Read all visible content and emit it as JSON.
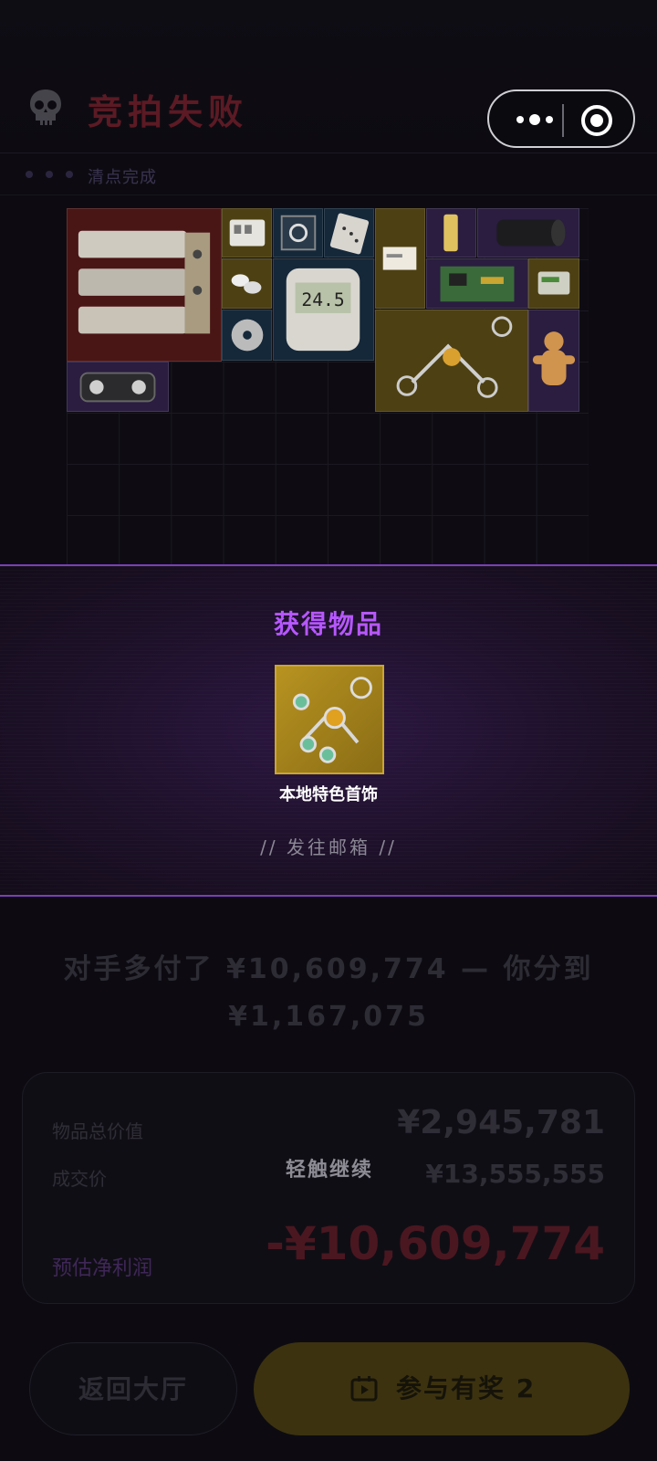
{
  "header": {
    "title": "竞拍失败",
    "subtitle": "清点完成",
    "skull_icon": "skull-icon",
    "more_icon": "more-dots-icon",
    "close_icon": "target-close-icon"
  },
  "inventory": {
    "items": [
      {
        "icon": "server-rack-icon",
        "rarity": "red"
      },
      {
        "icon": "switch-panel-icon",
        "rarity": "gold"
      },
      {
        "icon": "boxed-coil-icon",
        "rarity": "blue"
      },
      {
        "icon": "card-icon",
        "rarity": "blue"
      },
      {
        "icon": "small-card-icon",
        "rarity": "gold"
      },
      {
        "icon": "tube-icon",
        "rarity": "purple"
      },
      {
        "icon": "camera-lens-icon",
        "rarity": "purple"
      },
      {
        "icon": "capsules-icon",
        "rarity": "gold"
      },
      {
        "icon": "digital-scale-icon",
        "rarity": "blue",
        "label": "24.5"
      },
      {
        "icon": "circuit-board-icon",
        "rarity": "purple"
      },
      {
        "icon": "cartridge-icon",
        "rarity": "gold"
      },
      {
        "icon": "disc-icon",
        "rarity": "blue"
      },
      {
        "icon": "jewelry-icon",
        "rarity": "gold"
      },
      {
        "icon": "gingerbread-icon",
        "rarity": "purple"
      },
      {
        "icon": "radio-icon",
        "rarity": "purple"
      }
    ]
  },
  "acquired": {
    "title": "获得物品",
    "item_name": "本地特色首饰",
    "item_icon": "jewelry-icon",
    "mail_note": "// 发往邮箱 //"
  },
  "result": {
    "overpaid_line": "对手多付了 ¥10,609,774 — 你分到 ¥1,167,075",
    "rows": [
      {
        "label": "物品总价值",
        "value": "¥2,945,781"
      },
      {
        "label": "成交价",
        "value": "¥13,555,555"
      }
    ],
    "tap_hint": "轻触继续",
    "profit_label": "预估净利润",
    "profit_value": "-¥10,609,774"
  },
  "buttons": {
    "back": "返回大厅",
    "join": "参与有奖 2",
    "join_icon": "video-play-icon"
  }
}
